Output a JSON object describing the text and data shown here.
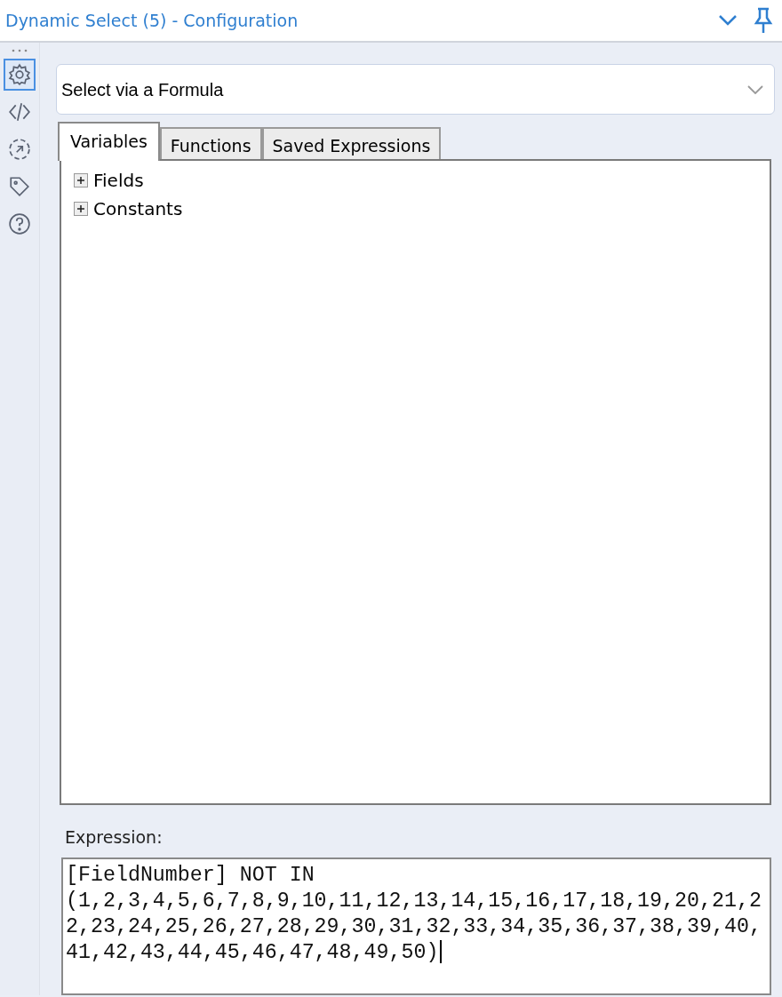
{
  "window": {
    "title": "Dynamic Select (5) - Configuration"
  },
  "sidebar": {
    "items": [
      {
        "kind": "gear",
        "selected": true
      },
      {
        "kind": "code",
        "selected": false
      },
      {
        "kind": "arrow-circle",
        "selected": false
      },
      {
        "kind": "tag",
        "selected": false
      },
      {
        "kind": "help",
        "selected": false
      }
    ]
  },
  "mode_select": {
    "value": "Select via a Formula"
  },
  "tabs": [
    {
      "label": "Variables",
      "selected": true
    },
    {
      "label": "Functions",
      "selected": false
    },
    {
      "label": "Saved Expressions",
      "selected": false
    }
  ],
  "tree": [
    {
      "label": "Fields",
      "expanded": false
    },
    {
      "label": "Constants",
      "expanded": false
    }
  ],
  "expression": {
    "label": "Expression:",
    "lines": [
      "[FieldNumber] NOT IN",
      "(1,2,3,4,5,6,7,8,9,10,11,12,13,14,15,16,17,18,19,20,21,2",
      "2,23,24,25,26,27,28,29,30,31,32,33,34,35,36,37,38,39,40,",
      "41,42,43,44,45,46,47,48,49,50)"
    ]
  }
}
